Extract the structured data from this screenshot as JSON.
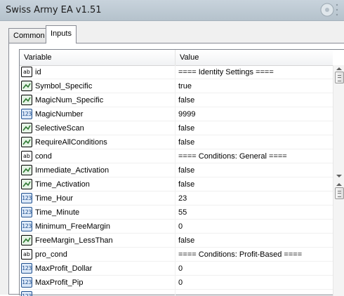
{
  "window": {
    "title": "Swiss Army EA v1.51"
  },
  "tabs": [
    {
      "label": "Common"
    },
    {
      "label": "Inputs"
    }
  ],
  "grid": {
    "headers": {
      "variable": "Variable",
      "value": "Value"
    },
    "rows": [
      {
        "icon": "string-type-icon",
        "variable": "id",
        "value": "==== Identity Settings ===="
      },
      {
        "icon": "bool-type-icon",
        "variable": "Symbol_Specific",
        "value": "true"
      },
      {
        "icon": "bool-type-icon",
        "variable": "MagicNum_Specific",
        "value": "false"
      },
      {
        "icon": "int-type-icon",
        "variable": "MagicNumber",
        "value": "9999"
      },
      {
        "icon": "bool-type-icon",
        "variable": "SelectiveScan",
        "value": "false"
      },
      {
        "icon": "bool-type-icon",
        "variable": "RequireAllConditions",
        "value": "false"
      },
      {
        "icon": "string-type-icon",
        "variable": "cond",
        "value": "==== Conditions: General ===="
      },
      {
        "icon": "bool-type-icon",
        "variable": "Immediate_Activation",
        "value": "false"
      },
      {
        "icon": "bool-type-icon",
        "variable": "Time_Activation",
        "value": "false"
      },
      {
        "icon": "int-type-icon",
        "variable": "Time_Hour",
        "value": "23"
      },
      {
        "icon": "int-type-icon",
        "variable": "Time_Minute",
        "value": "55"
      },
      {
        "icon": "int-type-icon",
        "variable": "Minimum_FreeMargin",
        "value": "0"
      },
      {
        "icon": "bool-type-icon",
        "variable": "FreeMargin_LessThan",
        "value": "false"
      },
      {
        "icon": "string-type-icon",
        "variable": "pro_cond",
        "value": "==== Conditions: Profit-Based ===="
      },
      {
        "icon": "int-type-icon",
        "variable": "MaxProfit_Dollar",
        "value": "0"
      },
      {
        "icon": "int-type-icon",
        "variable": "MaxProfit_Pip",
        "value": "0"
      },
      {
        "icon": "int-type-icon",
        "variable": "",
        "value": ""
      }
    ]
  },
  "icon_glyphs": {
    "string": "ab",
    "int": "123"
  },
  "colors": {
    "titlebar": "#c2ccd6",
    "selected_tab": "#ffffff",
    "string_icon": "#f7d47a",
    "bool_icon": "#3e8e41",
    "int_icon": "#3a6db5"
  }
}
